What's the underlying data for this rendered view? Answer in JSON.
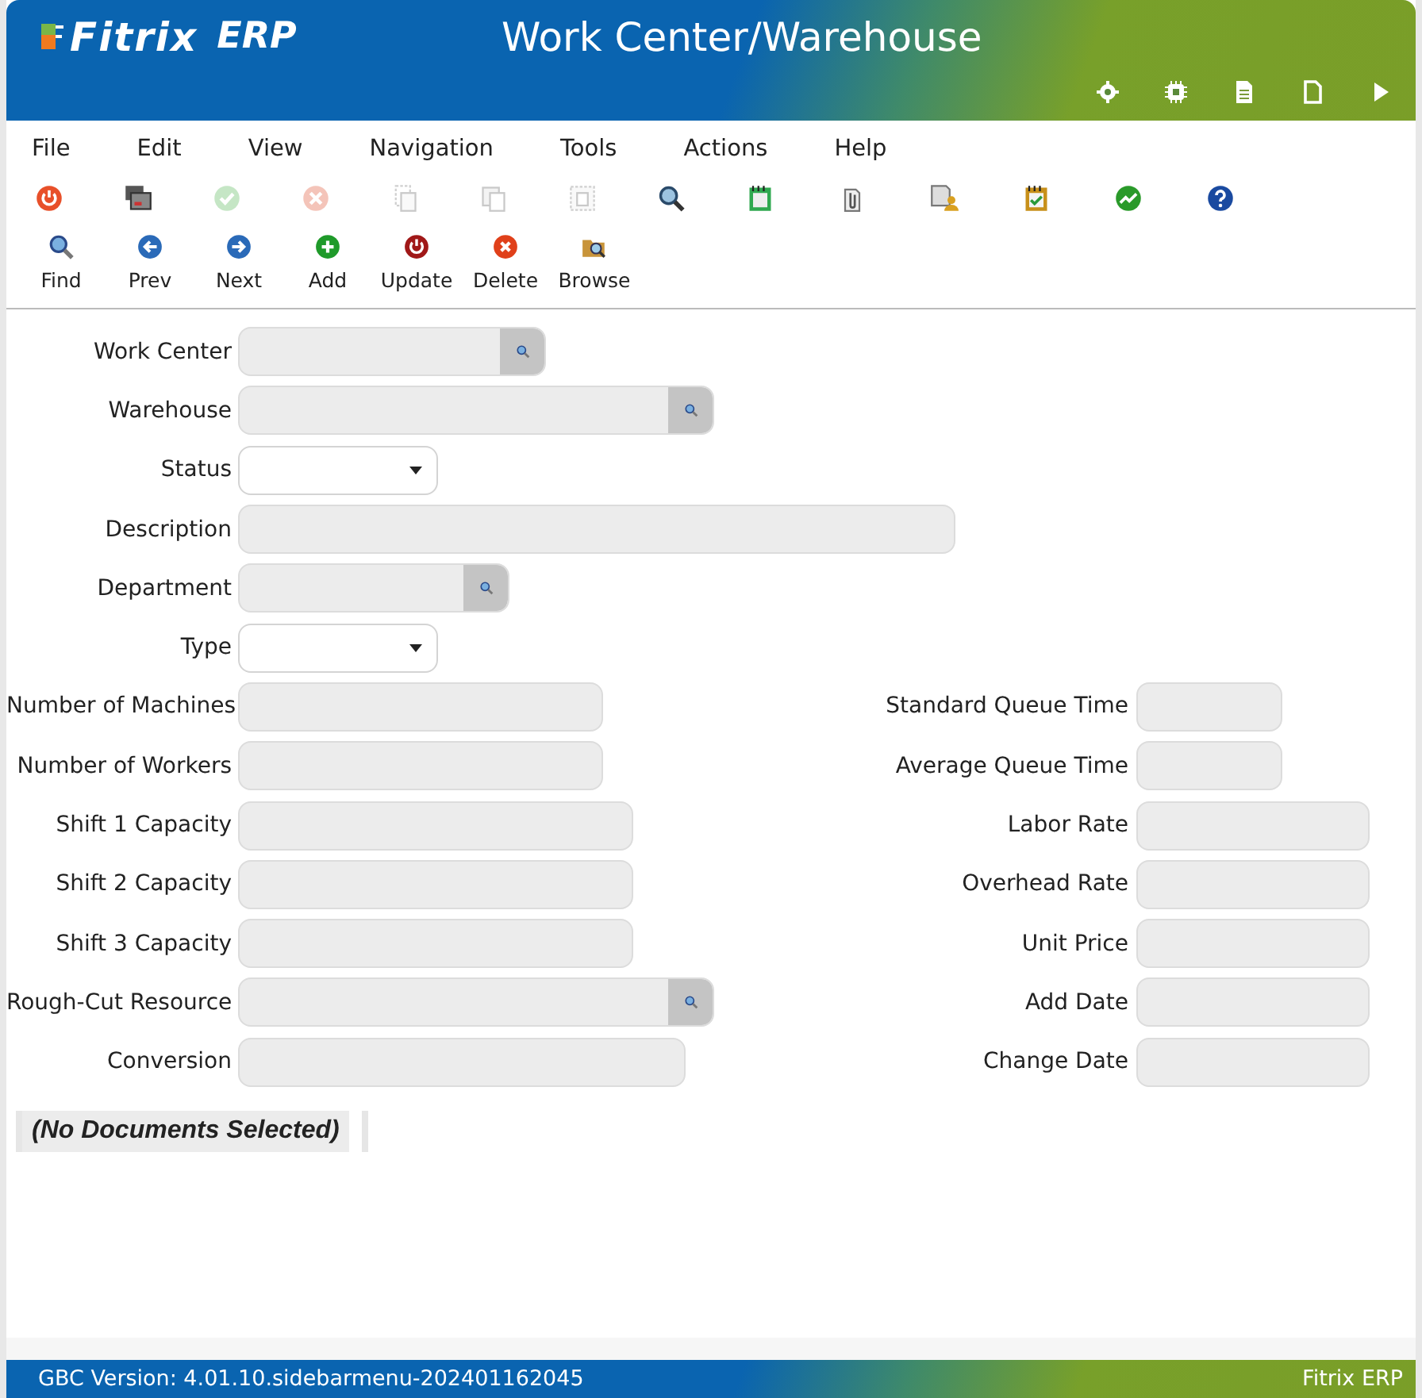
{
  "header": {
    "logo_brand": "Fitrix",
    "logo_suffix": "ERP",
    "title": "Work Center/Warehouse",
    "icons": [
      {
        "kind": "gear"
      },
      {
        "kind": "chip"
      },
      {
        "kind": "doc-filled"
      },
      {
        "kind": "doc-outline"
      },
      {
        "kind": "play"
      }
    ]
  },
  "menu": [
    "File",
    "Edit",
    "View",
    "Navigation",
    "Tools",
    "Actions",
    "Help"
  ],
  "toolbar_icons": [
    {
      "kind": "power",
      "disabled": false
    },
    {
      "kind": "screens",
      "disabled": false
    },
    {
      "kind": "check",
      "disabled": true
    },
    {
      "kind": "cancel",
      "disabled": true
    },
    {
      "kind": "copy",
      "disabled": true
    },
    {
      "kind": "paste",
      "disabled": true
    },
    {
      "kind": "select",
      "disabled": true
    },
    {
      "kind": "zoom",
      "disabled": false
    },
    {
      "kind": "notes",
      "disabled": false
    },
    {
      "kind": "attach",
      "disabled": false
    },
    {
      "kind": "user-doc",
      "disabled": false
    },
    {
      "kind": "checklist",
      "disabled": false
    },
    {
      "kind": "chart",
      "disabled": false
    },
    {
      "kind": "help",
      "disabled": false
    }
  ],
  "toolbar_buttons": [
    {
      "kind": "find",
      "label": "Find"
    },
    {
      "kind": "prev",
      "label": "Prev"
    },
    {
      "kind": "next",
      "label": "Next"
    },
    {
      "kind": "add",
      "label": "Add"
    },
    {
      "kind": "update",
      "label": "Update"
    },
    {
      "kind": "delete",
      "label": "Delete"
    },
    {
      "kind": "browse",
      "label": "Browse"
    }
  ],
  "form": {
    "top_fields": [
      {
        "label": "Work Center",
        "kind": "lookup"
      },
      {
        "label": "Warehouse",
        "kind": "lookup"
      },
      {
        "label": "Status",
        "kind": "select"
      },
      {
        "label": "Description",
        "kind": "text"
      },
      {
        "label": "Department",
        "kind": "lookup"
      },
      {
        "label": "Type",
        "kind": "select"
      }
    ],
    "left_fields": [
      {
        "label": "Number of Machines",
        "kind": "text"
      },
      {
        "label": "Number of Workers",
        "kind": "text"
      },
      {
        "label": "Shift 1 Capacity",
        "kind": "text"
      },
      {
        "label": "Shift 2 Capacity",
        "kind": "text"
      },
      {
        "label": "Shift 3 Capacity",
        "kind": "text"
      },
      {
        "label": "Rough-Cut Resource",
        "kind": "lookup"
      },
      {
        "label": "Conversion",
        "kind": "text"
      }
    ],
    "right_fields": [
      {
        "label": "Standard Queue Time",
        "kind": "text"
      },
      {
        "label": "Average Queue Time",
        "kind": "text"
      },
      {
        "label": "Labor Rate",
        "kind": "text"
      },
      {
        "label": "Overhead Rate",
        "kind": "text"
      },
      {
        "label": "Unit Price",
        "kind": "text"
      },
      {
        "label": "Add Date",
        "kind": "text"
      },
      {
        "label": "Change Date",
        "kind": "text"
      }
    ]
  },
  "documents": "(No Documents Selected)",
  "status_bar": {
    "version": "GBC Version: 4.01.10.sidebarmenu-202401162045",
    "product": "Fitrix ERP"
  }
}
